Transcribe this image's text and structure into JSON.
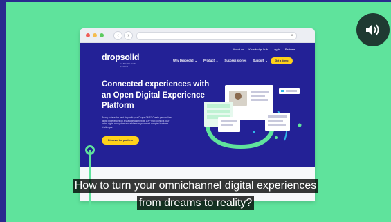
{
  "video": {
    "sound_icon": "speaker-volume-icon",
    "subtitles": [
      "How to turn your omnichannel digital experiences",
      "from dreams to reality?"
    ]
  },
  "browser": {
    "back_icon": "arrow-left-icon",
    "forward_icon": "arrow-right-icon",
    "search_icon": "magnifier-icon",
    "menu_icon": "vertical-dots-icon"
  },
  "site": {
    "logo": "dropsolid",
    "logo_sub": [
      "EXPERIENCE",
      "CLOUD"
    ],
    "top_links": [
      "About us",
      "Knowledge hub",
      "Log in",
      "Partners"
    ],
    "nav": [
      "Why Dropsolid",
      "Product",
      "Success stories",
      "Support"
    ],
    "cta": "Get a demo",
    "hero_title": "Connected experiences with an Open Digital Experience Platform",
    "hero_text": "Ready to take the next step with your Drupal CMS? Create personalized digital experiences on a scalable and flexible DXP that connects your entire digital ecosystem and addresses your most complex business challenges.",
    "hero_button": "Discover the platform"
  },
  "colors": {
    "background": "#5fe39c",
    "site_navy": "#232196",
    "accent_yellow": "#ffd21a",
    "accent_green": "#5fe39c"
  }
}
